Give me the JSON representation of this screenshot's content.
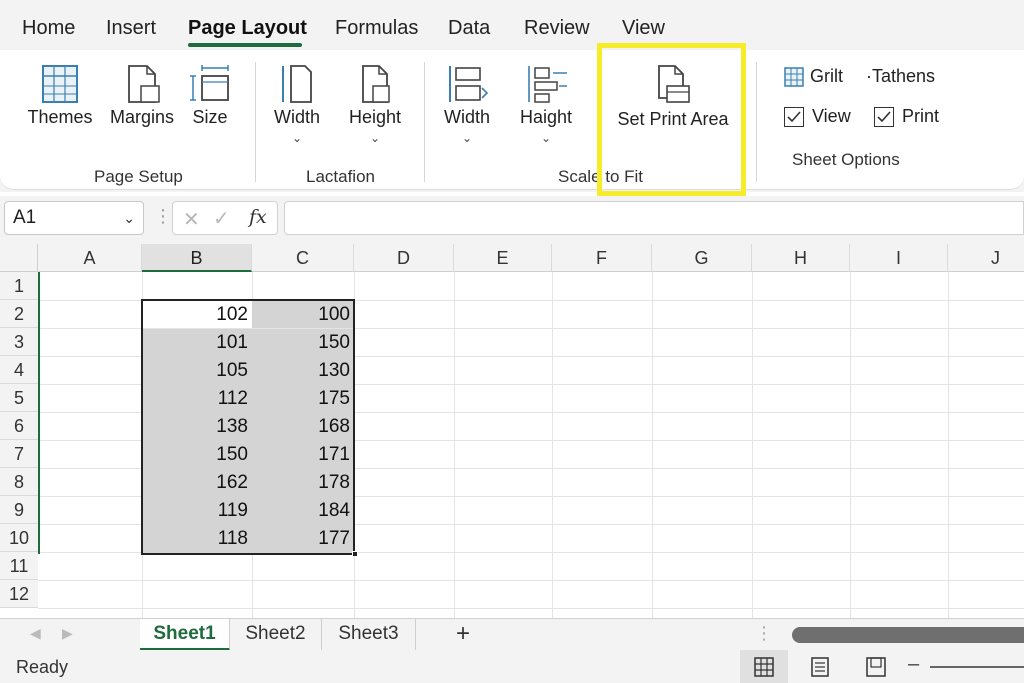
{
  "menu": {
    "tabs": [
      {
        "label": "Home"
      },
      {
        "label": "Insert"
      },
      {
        "label": "Page Layout"
      },
      {
        "label": "Formulas"
      },
      {
        "label": "Data"
      },
      {
        "label": "Review"
      },
      {
        "label": "View"
      }
    ],
    "active_tab": "Page Layout",
    "accent_color": "#1f6b3d"
  },
  "ribbon": {
    "page_setup": {
      "group_label": "Page Setup",
      "themes": "Themes",
      "margins": "Margins",
      "size": "Size"
    },
    "lactafion": {
      "group_label": "Lactafion",
      "width": "Width",
      "height": "Height"
    },
    "scale_to_fit": {
      "group_label": "Scale to Fit",
      "width": "Width",
      "height": "Haight",
      "set_print_area": "Set Print Area"
    },
    "sheet_options": {
      "group_label": "Sheet Options",
      "gridlines": "Grilt",
      "headings": "·Tathens",
      "view": "View",
      "print": "Print",
      "view_checked": true,
      "print_checked": true
    },
    "highlight_color": "#f7ec2a"
  },
  "formula_bar": {
    "name_box": "A1",
    "fx_label": "fx",
    "formula": ""
  },
  "grid": {
    "columns": [
      "A",
      "B",
      "C",
      "D",
      "E",
      "F",
      "G",
      "H",
      "I",
      "J"
    ],
    "rows": [
      "1",
      "2",
      "3",
      "4",
      "5",
      "6",
      "7",
      "8",
      "9",
      "10",
      "11",
      "12"
    ],
    "selected_column": "B",
    "data": [
      {
        "row": "2",
        "b": "102",
        "c": "100"
      },
      {
        "row": "3",
        "b": "101",
        "c": "150"
      },
      {
        "row": "4",
        "b": "105",
        "c": "130"
      },
      {
        "row": "5",
        "b": "112",
        "c": "175"
      },
      {
        "row": "6",
        "b": "138",
        "c": "168"
      },
      {
        "row": "7",
        "b": "150",
        "c": "171"
      },
      {
        "row": "8",
        "b": "162",
        "c": "178"
      },
      {
        "row": "9",
        "b": "119",
        "c": "184"
      },
      {
        "row": "10",
        "b": "118",
        "c": "177"
      }
    ]
  },
  "sheets": {
    "tabs": [
      "Sheet1",
      "Sheet2",
      "Sheet3"
    ],
    "active": "Sheet1",
    "add_label": "+"
  },
  "status_bar": {
    "status": "Ready"
  }
}
